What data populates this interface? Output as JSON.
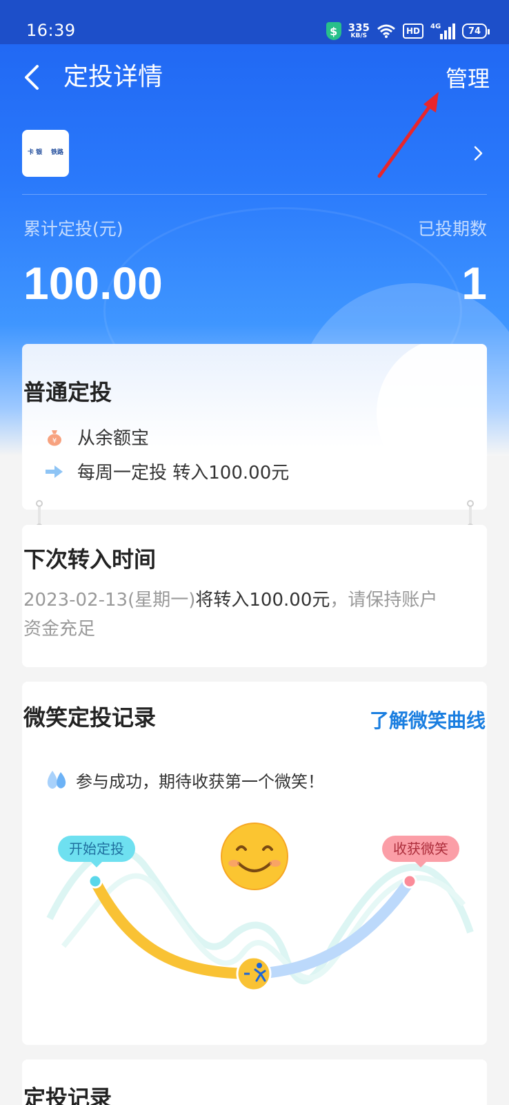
{
  "status_bar": {
    "time": "16:39",
    "speed_value": "335",
    "speed_unit": "KB/S",
    "hd": "HD",
    "network": "4G",
    "battery": "74"
  },
  "nav": {
    "title": "定投详情",
    "manage": "管理"
  },
  "fund": {
    "logo_left": "卡\n银",
    "logo_right": "铁路"
  },
  "stats": {
    "total_label": "累计定投(元)",
    "total_value": "100.00",
    "periods_label": "已投期数",
    "periods_value": "1"
  },
  "plan": {
    "title": "普通定投",
    "source": "从余额宝",
    "schedule": "每周一定投 转入100.00元"
  },
  "next": {
    "title": "下次转入时间",
    "date": "2023-02-13(星期一)",
    "amount_text": "将转入100.00元",
    "note": "，请保持账户资金充足"
  },
  "smile": {
    "title": "微笑定投记录",
    "link": "了解微笑曲线",
    "tip": "参与成功，期待收获第一个微笑！",
    "start_label": "开始定投",
    "end_label": "收获微笑"
  },
  "records": {
    "title": "定投记录"
  },
  "colors": {
    "brand_blue": "#2a79fb",
    "link_blue": "#1a7ee0",
    "curve_yellow": "#f9c234",
    "curve_blue": "#bcd9fb",
    "annotation_red": "#e8262b"
  }
}
